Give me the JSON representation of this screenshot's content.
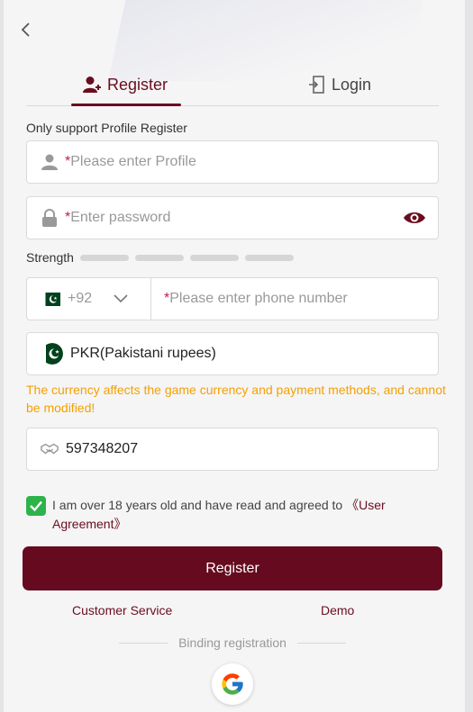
{
  "tabs": {
    "register": "Register",
    "login": "Login"
  },
  "hint": "Only support Profile Register",
  "profile": {
    "required_mark": "*",
    "placeholder": "Please enter Profile"
  },
  "password": {
    "required_mark": "*",
    "placeholder": "Enter password"
  },
  "strength": {
    "label": "Strength",
    "level_filled": 0,
    "segments": 4
  },
  "phone": {
    "country_code": "+92",
    "required_mark": "*",
    "placeholder": "Please enter phone number"
  },
  "currency": {
    "value": "PKR(Pakistani rupees)"
  },
  "warning": "The currency affects the game currency and payment methods, and cannot be modified!",
  "invite": {
    "value": "597348207"
  },
  "agreement": {
    "checked": true,
    "text": "I am over 18 years old and have read and agreed to ",
    "link": "《User Agreement》"
  },
  "register_button": "Register",
  "footer": {
    "customer_service": "Customer Service",
    "demo": "Demo"
  },
  "binding": {
    "label": "Binding registration",
    "providers": [
      "google-icon"
    ]
  },
  "icons": {
    "back": "chevron-left-icon",
    "register": "user-add-icon",
    "login": "login-door-icon",
    "profile": "user-icon",
    "password": "lock-icon",
    "show_password": "eye-icon",
    "dropdown": "chevron-down-icon",
    "invite": "handshake-icon"
  },
  "colors": {
    "accent": "#660b1f",
    "check": "#2eb34a",
    "warning": "#f5a000",
    "required": "#c2185b"
  }
}
